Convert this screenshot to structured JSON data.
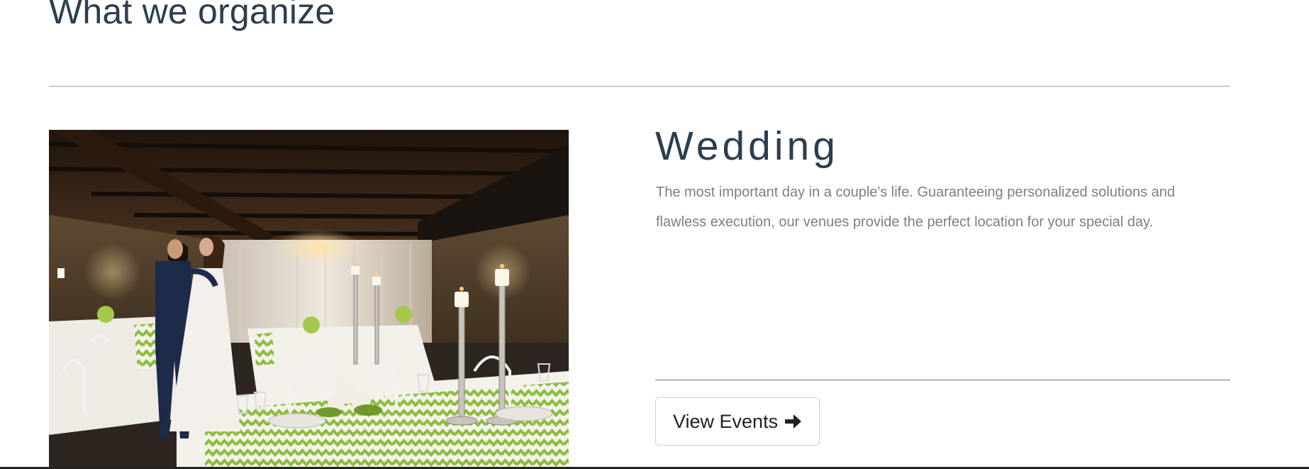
{
  "section": {
    "title": "What we organize"
  },
  "event": {
    "title": "Wedding",
    "description": "The most important day in a couple's life. Guaranteeing personalized solutions and flawless execution, our venues provide the perfect location for your special day.",
    "image_alt": "Couple dancing in a candlelit banquet venue with white-draped tables",
    "button_label": "View Events",
    "button_icon": "arrow-right-icon"
  },
  "colors": {
    "heading": "#2c3e50",
    "body_text": "#7b7f84",
    "divider": "#a3a3a3",
    "table_runner": "#8dbb3c"
  }
}
